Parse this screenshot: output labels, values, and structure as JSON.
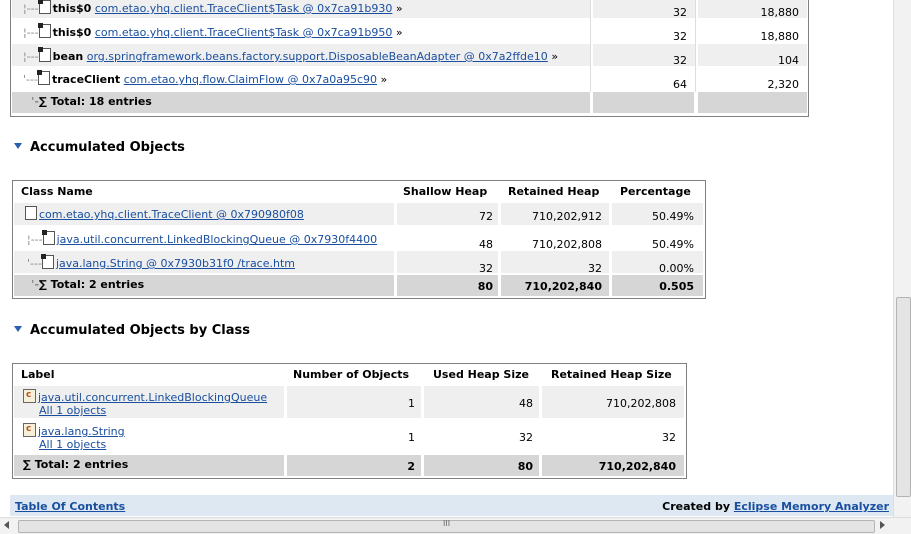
{
  "top_table": {
    "rows": [
      {
        "name": "this$0",
        "link": "com.etao.yhq.client.TraceClient$Task @ 0x7ca91b930",
        "arrow": "»",
        "shallow": "32",
        "retained": "18,880"
      },
      {
        "name": "this$0",
        "link": "com.etao.yhq.client.TraceClient$Task @ 0x7ca91b950",
        "arrow": "»",
        "shallow": "32",
        "retained": "18,880"
      },
      {
        "name": "bean",
        "link": "org.springframework.beans.factory.support.DisposableBeanAdapter @ 0x7a2ffde10",
        "arrow": "»",
        "shallow": "32",
        "retained": "104"
      },
      {
        "name": "traceClient",
        "link": "com.etao.yhq.flow.ClaimFlow @ 0x7a0a95c90",
        "arrow": "»",
        "shallow": "64",
        "retained": "2,320"
      }
    ],
    "total": "Total: 18 entries"
  },
  "accumulated_objects": {
    "heading": "Accumulated Objects",
    "headers": [
      "Class Name",
      "Shallow Heap",
      "Retained Heap",
      "Percentage"
    ],
    "rows": [
      {
        "link": "com.etao.yhq.client.TraceClient @ 0x790980f08",
        "shallow": "72",
        "retained": "710,202,912",
        "pct": "50.49%"
      },
      {
        "link": "java.util.concurrent.LinkedBlockingQueue @ 0x7930f4400",
        "shallow": "48",
        "retained": "710,202,808",
        "pct": "50.49%"
      },
      {
        "link": "java.lang.String @ 0x7930b31f0 /trace.htm",
        "shallow": "32",
        "retained": "32",
        "pct": "0.00%"
      }
    ],
    "total": {
      "label": "Total: 2 entries",
      "shallow": "80",
      "retained": "710,202,840",
      "pct": "0.505"
    }
  },
  "accumulated_by_class": {
    "heading": "Accumulated Objects by Class",
    "headers": [
      "Label",
      "Number of Objects",
      "Used Heap Size",
      "Retained Heap Size"
    ],
    "rows": [
      {
        "link": "java.util.concurrent.LinkedBlockingQueue",
        "sub": "All 1 objects",
        "count": "1",
        "used": "48",
        "retained": "710,202,808"
      },
      {
        "link": "java.lang.String",
        "sub": "All 1 objects",
        "count": "1",
        "used": "32",
        "retained": "32"
      }
    ],
    "total": {
      "label": "Total: 2 entries",
      "count": "2",
      "used": "80",
      "retained": "710,202,840"
    }
  },
  "footer": {
    "toc": "Table Of Contents",
    "created_by": "Created by",
    "tool": "Eclipse Memory Analyzer"
  },
  "scrollbar": {
    "h_grip": "III"
  },
  "colors": {
    "link": "#1a4fa0",
    "total_bg": "#d6d6d6",
    "footer_bg": "#dde8f2"
  }
}
